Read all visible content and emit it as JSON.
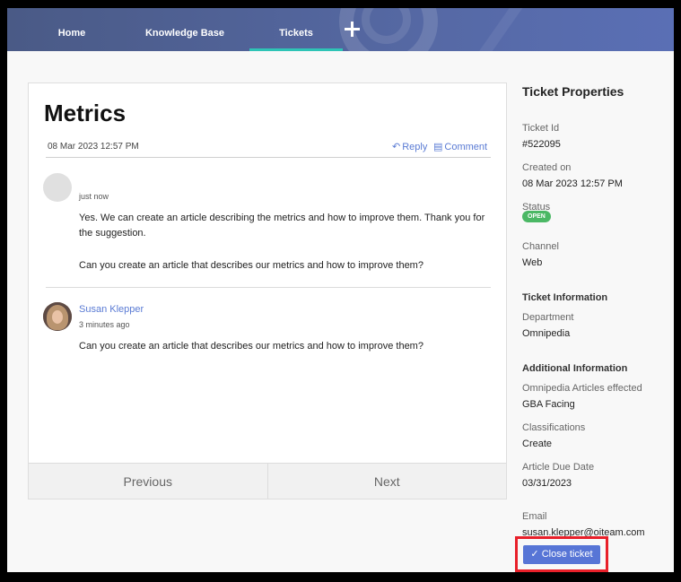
{
  "nav": {
    "items": [
      {
        "label": "Home"
      },
      {
        "label": "Knowledge Base"
      },
      {
        "label": "Tickets"
      }
    ],
    "active": "Tickets"
  },
  "ticket": {
    "title": "Metrics",
    "date": "08 Mar 2023 12:57 PM",
    "reply_label": "Reply",
    "comment_label": "Comment",
    "comments": [
      {
        "time": "just now",
        "text_1": "Yes. We can create an article describing the metrics and how to improve them. Thank you for the suggestion.",
        "text_2": "Can you create an article that describes our metrics and how to improve them?"
      },
      {
        "author": "Susan Klepper",
        "time": "3 minutes ago",
        "text": "Can you create an article that describes our metrics and how to improve them?"
      }
    ],
    "pager": {
      "previous": "Previous",
      "next": "Next"
    }
  },
  "properties": {
    "title": "Ticket Properties",
    "ticket_id_label": "Ticket Id",
    "ticket_id": "#522095",
    "created_label": "Created on",
    "created": "08 Mar 2023 12:57 PM",
    "status_label": "Status",
    "status": "OPEN",
    "channel_label": "Channel",
    "channel": "Web",
    "ticket_info_heading": "Ticket Information",
    "department_label": "Department",
    "department": "Omnipedia",
    "additional_heading": "Additional Information",
    "articles_label": "Omnipedia Articles effected",
    "articles": "GBA Facing",
    "classifications_label": "Classifications",
    "classifications": "Create",
    "due_label": "Article Due Date",
    "due": "03/31/2023",
    "email_label": "Email",
    "email": "susan.klepper@oiteam.com",
    "close_label": "Close ticket"
  },
  "colors": {
    "nav": "#5568a3",
    "link": "#5a7bd4",
    "status_open": "#4bb865",
    "close_button": "#5775d6",
    "highlight": "#e8202a"
  }
}
